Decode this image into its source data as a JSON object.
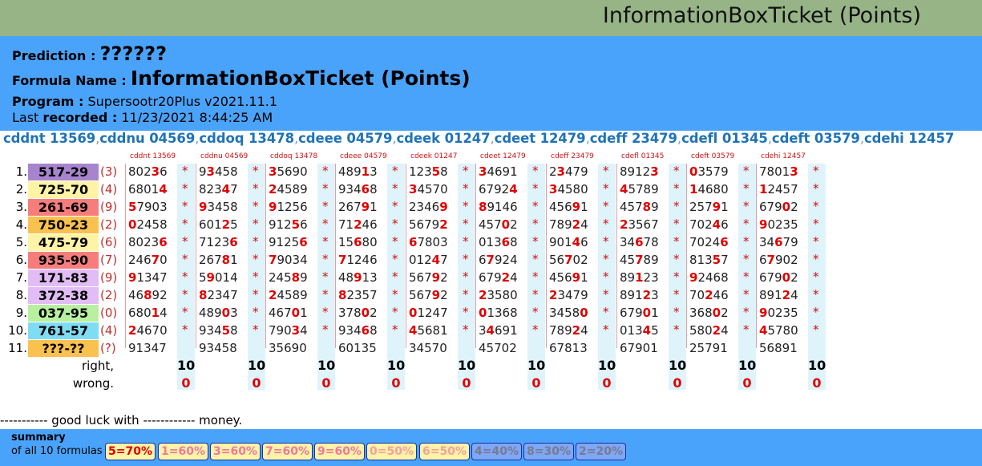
{
  "title": "InformationBoxTicket (Points)",
  "prediction": {
    "label": "Prediction :",
    "value": "??????"
  },
  "formula": {
    "label": "Formula Name :",
    "value": "InformationBoxTicket (Points)"
  },
  "program": {
    "label": "Program :",
    "value": "Supersootr20Plus v2021.11.1"
  },
  "recorded": {
    "label_pre": "Last",
    "label_bold": "recorded :",
    "value": "11/23/2021 8:44:25 AM"
  },
  "formulas": [
    "cddnt 13569",
    "cddnu 04569",
    "cddoq 13478",
    "cdeee 04579",
    "cdeek 01247",
    "cdeet 12479",
    "cdeff 23479",
    "cdefl 01345",
    "cdeft 03579",
    "cdehi 12457"
  ],
  "rows": [
    {
      "num": "1.",
      "pair": "517-29",
      "count": "(3)",
      "color": "#a884cf"
    },
    {
      "num": "2.",
      "pair": "725-70",
      "count": "(4)",
      "color": "#fff3a6"
    },
    {
      "num": "3.",
      "pair": "261-69",
      "count": "(9)",
      "color": "#f77d7d"
    },
    {
      "num": "4.",
      "pair": "750-23",
      "count": "(2)",
      "color": "#f9c14e"
    },
    {
      "num": "5.",
      "pair": "475-79",
      "count": "(6)",
      "color": "#fff3a6"
    },
    {
      "num": "6.",
      "pair": "935-90",
      "count": "(7)",
      "color": "#f77d7d"
    },
    {
      "num": "7.",
      "pair": "171-83",
      "count": "(9)",
      "color": "#e2bdf5"
    },
    {
      "num": "8.",
      "pair": "372-38",
      "count": "(2)",
      "color": "#e2bdf5"
    },
    {
      "num": "9.",
      "pair": "037-95",
      "count": "(0)",
      "color": "#b8f0a0"
    },
    {
      "num": "10.",
      "pair": "761-57",
      "count": "(4)",
      "color": "#7fdcf3"
    },
    {
      "num": "11.",
      "pair": "???-??",
      "count": "(?)",
      "color": "#f9c14e"
    }
  ],
  "cells": [
    [
      "80236",
      "93458",
      "35690",
      "48913",
      "12358",
      "34691",
      "23479",
      "89123",
      "03579",
      "78013"
    ],
    [
      "68014",
      "82347",
      "24589",
      "93468",
      "34570",
      "67924",
      "34580",
      "45789",
      "14680",
      "12457"
    ],
    [
      "57903",
      "93458",
      "91256",
      "26791",
      "23469",
      "89146",
      "45691",
      "45789",
      "25791",
      "67902"
    ],
    [
      "02458",
      "60125",
      "91256",
      "71246",
      "56792",
      "45702",
      "78924",
      "23567",
      "70246",
      "90235"
    ],
    [
      "80236",
      "71236",
      "91256",
      "15680",
      "67803",
      "01368",
      "90146",
      "34678",
      "70246",
      "34679"
    ],
    [
      "24670",
      "26781",
      "79034",
      "71246",
      "01247",
      "67924",
      "56702",
      "45789",
      "81357",
      "67902"
    ],
    [
      "91347",
      "59014",
      "24589",
      "48913",
      "56792",
      "67924",
      "45691",
      "89123",
      "92468",
      "67902"
    ],
    [
      "46892",
      "82347",
      "24589",
      "82357",
      "56792",
      "23580",
      "23479",
      "89123",
      "70246",
      "89124"
    ],
    [
      "68014",
      "48903",
      "46701",
      "37802",
      "01247",
      "01368",
      "34580",
      "67901",
      "36802",
      "90235"
    ],
    [
      "24670",
      "93458",
      "79034",
      "93468",
      "45681",
      "34691",
      "78924",
      "01345",
      "58024",
      "45780"
    ],
    [
      "91347",
      "93458",
      "35690",
      "60135",
      "34570",
      "45702",
      "67813",
      "67901",
      "25791",
      "56891"
    ]
  ],
  "highlights": [
    [
      [
        3
      ],
      [
        1
      ],
      [
        0
      ],
      [
        3
      ],
      [
        3
      ],
      [
        0
      ],
      [
        1
      ],
      [
        4
      ],
      [
        0
      ],
      [
        4
      ]
    ],
    [
      [
        4
      ],
      [
        3
      ],
      [
        0
      ],
      [
        3
      ],
      [
        0
      ],
      [
        4
      ],
      [
        0
      ],
      [
        0
      ],
      [
        0
      ],
      [
        0
      ]
    ],
    [
      [
        0
      ],
      [
        0
      ],
      [
        0
      ],
      [
        3
      ],
      [
        4
      ],
      [
        0
      ],
      [
        3
      ],
      [
        3
      ],
      [
        3
      ],
      [
        3
      ]
    ],
    [
      [
        0
      ],
      [
        3
      ],
      [
        3
      ],
      [
        2
      ],
      [
        4
      ],
      [
        3
      ],
      [
        3
      ],
      [
        0
      ],
      [
        3
      ],
      [
        0
      ]
    ],
    [
      [
        4
      ],
      [
        4
      ],
      [
        4
      ],
      [
        2
      ],
      [
        0
      ],
      [
        3
      ],
      [
        3
      ],
      [
        2
      ],
      [
        4
      ],
      [
        2
      ]
    ],
    [
      [
        3
      ],
      [
        3
      ],
      [
        0
      ],
      [
        0
      ],
      [
        3
      ],
      [
        1
      ],
      [
        2
      ],
      [
        2
      ],
      [
        3
      ],
      [
        1
      ]
    ],
    [
      [
        0
      ],
      [
        1
      ],
      [
        3
      ],
      [
        2
      ],
      [
        3
      ],
      [
        3
      ],
      [
        3
      ],
      [
        2
      ],
      [
        0
      ],
      [
        3
      ]
    ],
    [
      [
        2
      ],
      [
        0
      ],
      [
        0
      ],
      [
        0
      ],
      [
        3
      ],
      [
        0
      ],
      [
        0
      ],
      [
        3
      ],
      [
        2
      ],
      [
        3
      ]
    ],
    [
      [
        3
      ],
      [
        3
      ],
      [
        3
      ],
      [
        3
      ],
      [
        0
      ],
      [
        0
      ],
      [
        4
      ],
      [
        3
      ],
      [
        3
      ],
      [
        0
      ]
    ],
    [
      [
        0
      ],
      [
        3
      ],
      [
        3
      ],
      [
        3
      ],
      [
        0
      ],
      [
        1
      ],
      [
        3
      ],
      [
        3
      ],
      [
        3
      ],
      [
        0
      ]
    ],
    [
      [],
      [],
      [],
      [],
      [],
      [],
      [],
      [],
      [],
      []
    ]
  ],
  "star": "*",
  "right_label": "right,",
  "wrong_label": "wrong.",
  "right_values": [
    "10",
    "10",
    "10",
    "10",
    "10",
    "10",
    "10",
    "10",
    "10",
    "10"
  ],
  "wrong_values": [
    "0",
    "0",
    "0",
    "0",
    "0",
    "0",
    "0",
    "0",
    "0",
    "0"
  ],
  "good_luck": "----------- good luck with ------------ money.",
  "summary": {
    "label": "summary",
    "sub": "of all 10 formulas",
    "badges": [
      {
        "text": "5=70%",
        "bg": "#fff3a6",
        "fg": "#e00000"
      },
      {
        "text": "1=60%",
        "bg": "#fff3a6",
        "fg": "#f077a0"
      },
      {
        "text": "3=60%",
        "bg": "#fff3a6",
        "fg": "#f077a0"
      },
      {
        "text": "7=60%",
        "bg": "#fff3a6",
        "fg": "#f077a0"
      },
      {
        "text": "9=60%",
        "bg": "#fff3a6",
        "fg": "#f077a0"
      },
      {
        "text": "0=50%",
        "bg": "#fff3a6",
        "fg": "#f5a0a0"
      },
      {
        "text": "6=50%",
        "bg": "#fff3a6",
        "fg": "#f5a0a0"
      },
      {
        "text": "4=40%",
        "bg": "#7da8f5",
        "fg": "#7a7a90"
      },
      {
        "text": "8=30%",
        "bg": "#7da8f5",
        "fg": "#7a7a90"
      },
      {
        "text": "2=20%",
        "bg": "#7da8f5",
        "fg": "#7a7a90"
      }
    ]
  }
}
